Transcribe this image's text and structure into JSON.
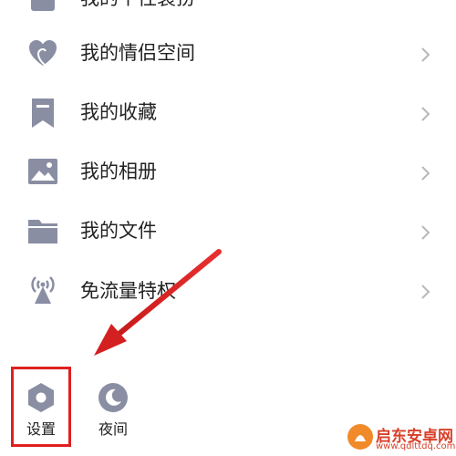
{
  "menu": {
    "items": [
      {
        "label": "我的个性装扮",
        "icon": "tshirt-icon"
      },
      {
        "label": "我的情侣空间",
        "icon": "heart-icon"
      },
      {
        "label": "我的收藏",
        "icon": "bookmark-icon"
      },
      {
        "label": "我的相册",
        "icon": "image-icon"
      },
      {
        "label": "我的文件",
        "icon": "folder-icon"
      },
      {
        "label": "免流量特权",
        "icon": "signal-tower-icon"
      }
    ]
  },
  "bottom_bar": {
    "settings_label": "设置",
    "night_label": "夜间"
  },
  "watermark": {
    "name": "启东安卓网",
    "url": "www.qdlttdq.com"
  },
  "colors": {
    "icon": "#8a8ea3",
    "chevron": "#b8b8b8",
    "highlight": "#e02020",
    "watermark": "#d8402a"
  }
}
